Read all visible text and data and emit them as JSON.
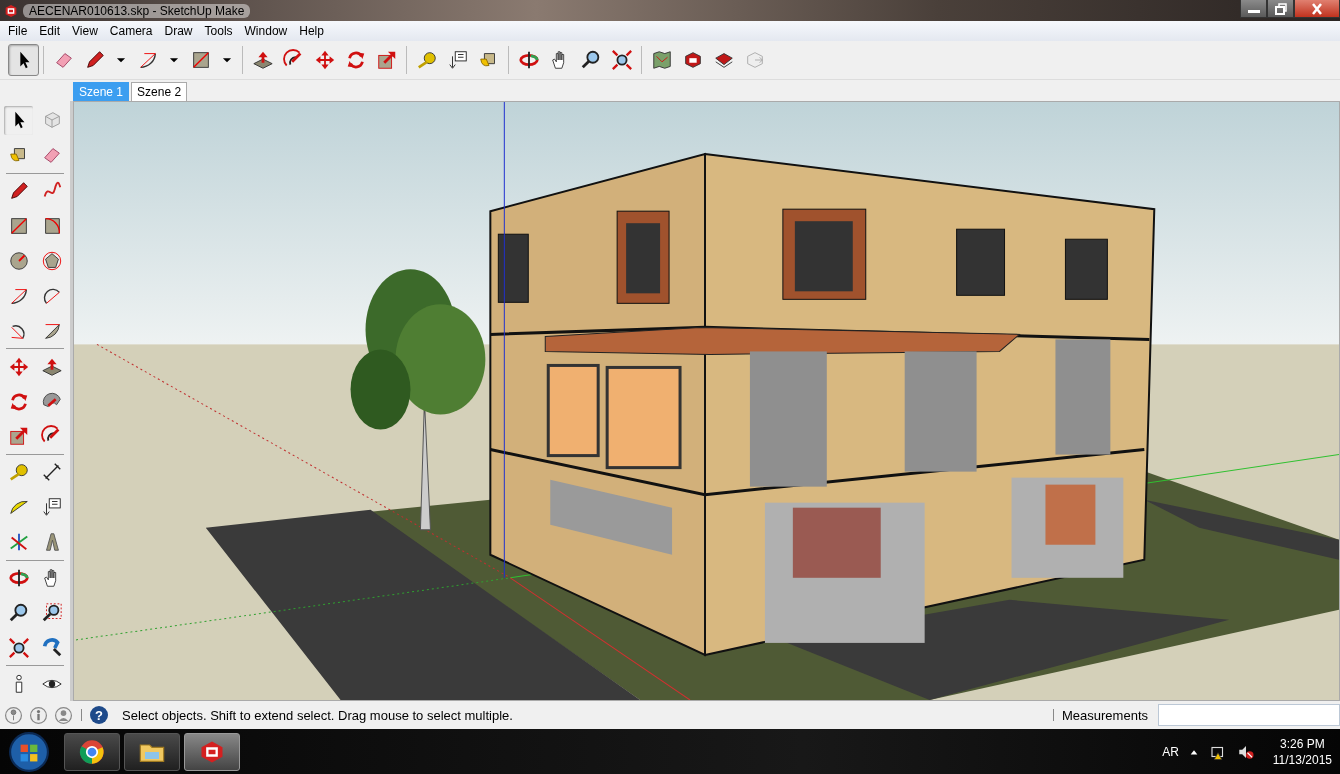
{
  "window": {
    "title": "AECENAR010613.skp - SketchUp Make"
  },
  "menu": [
    "File",
    "Edit",
    "View",
    "Camera",
    "Draw",
    "Tools",
    "Window",
    "Help"
  ],
  "tools": {
    "select_active": true
  },
  "scene_tabs": [
    {
      "label": "Szene 1",
      "selected": true
    },
    {
      "label": "Szene 2",
      "selected": false
    }
  ],
  "status_bar": {
    "help_icon": "?",
    "hint": "Select objects. Shift to extend select. Drag mouse to select multiple.",
    "measurements_label": "Measurements"
  },
  "tray": {
    "language": "AR",
    "time": "3:26 PM",
    "date": "11/13/2015"
  }
}
